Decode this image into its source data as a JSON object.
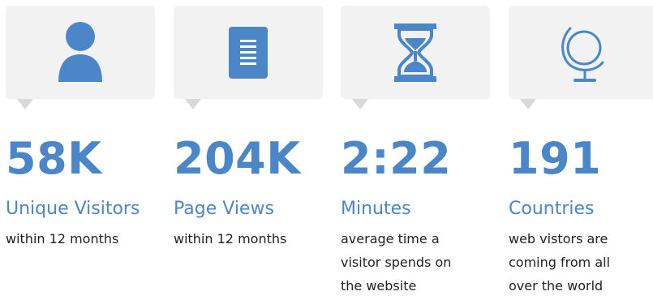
{
  "accent_color": "#4a86c8",
  "card_color": "#f2f2f2",
  "stats": [
    {
      "icon": "person-icon",
      "value": "58K",
      "label": "Unique Visitors",
      "description": "within 12 months"
    },
    {
      "icon": "document-icon",
      "value": "204K",
      "label": "Page Views",
      "description": "within 12 months"
    },
    {
      "icon": "hourglass-icon",
      "value": "2:22",
      "label": "Minutes",
      "description": "average time a\nvisitor spends on\nthe website"
    },
    {
      "icon": "globe-icon",
      "value": "191",
      "label": "Countries",
      "description": "web vistors are\ncoming from all\nover the world"
    }
  ]
}
